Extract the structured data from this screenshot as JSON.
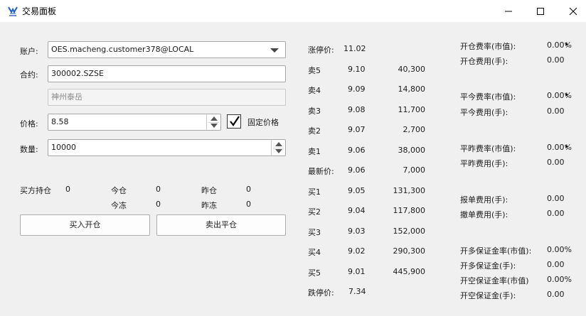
{
  "window": {
    "title": "交易面板"
  },
  "form": {
    "account_label": "账户:",
    "account_value": "OES.macheng.customer378@LOCAL",
    "contract_label": "合约:",
    "contract_value": "300002.SZSE",
    "contract_name": "神州泰岳",
    "price_label": "价格:",
    "price_value": "8.58",
    "fixed_price_label": "固定价格",
    "fixed_price_checked": true,
    "quantity_label": "数量:",
    "quantity_value": "10000"
  },
  "position": {
    "long_position_label": "买方持仓",
    "long_position_value": "0",
    "today_label": "今仓",
    "today_value": "0",
    "yesterday_label": "昨仓",
    "yesterday_value": "0",
    "today_frozen_label": "今冻",
    "today_frozen_value": "0",
    "yesterday_frozen_label": "昨冻",
    "yesterday_frozen_value": "0"
  },
  "buttons": {
    "buy_open": "买入开仓",
    "sell_close": "卖出平仓"
  },
  "quote": {
    "limit_up_label": "涨停价:",
    "limit_up_value": "11.02",
    "limit_down_label": "跌停价:",
    "limit_down_value": "7.34",
    "asks": [
      {
        "label": "卖5",
        "price": "9.10",
        "volume": "40,300"
      },
      {
        "label": "卖4",
        "price": "9.09",
        "volume": "14,800"
      },
      {
        "label": "卖3",
        "price": "9.08",
        "volume": "11,700"
      },
      {
        "label": "卖2",
        "price": "9.07",
        "volume": "2,700"
      },
      {
        "label": "卖1",
        "price": "9.06",
        "volume": "38,000"
      }
    ],
    "last": {
      "label": "最新价:",
      "price": "9.06",
      "volume": "7,000"
    },
    "bids": [
      {
        "label": "买1",
        "price": "9.05",
        "volume": "131,300"
      },
      {
        "label": "买2",
        "price": "9.04",
        "volume": "117,800"
      },
      {
        "label": "买3",
        "price": "9.03",
        "volume": "152,000"
      },
      {
        "label": "买4",
        "price": "9.02",
        "volume": "290,300"
      },
      {
        "label": "买5",
        "price": "9.01",
        "volume": "445,900"
      }
    ]
  },
  "fees": [
    {
      "label": "开仓费率(市值):",
      "value": "0.00%"
    },
    {
      "label": "开仓费用(手):",
      "value": "0.00"
    },
    {
      "label": "平今费率(市值):",
      "value": "0.00%"
    },
    {
      "label": "平今费用(手):",
      "value": "0.00"
    },
    {
      "label": "平昨费率(市值):",
      "value": "0.00%"
    },
    {
      "label": "平昨费用(手):",
      "value": "0.00"
    },
    {
      "label": "报单费用(手):",
      "value": "0.00"
    },
    {
      "label": "撤单费用(手):",
      "value": "0.00"
    },
    {
      "label": "开多保证金率(市值):",
      "value": "0.00%"
    },
    {
      "label": "开多保证金(手):",
      "value": "0.00"
    },
    {
      "label": "开空保证金率(市值)",
      "value": "0.00%"
    },
    {
      "label": "开空保证金(手):",
      "value": "0.00"
    }
  ],
  "icons": {
    "app": "app-logo-icon",
    "minimize": "minimize-icon",
    "maximize": "maximize-icon",
    "close": "close-icon",
    "dropdown": "chevron-down-icon",
    "checkmark": "checkmark-icon",
    "cursor": "pointer-cursor-icon"
  },
  "colors": {
    "window_bg": "#f0f0f0",
    "titlebar_bg": "#ffffff",
    "app_icon": "#1f5fbf"
  }
}
